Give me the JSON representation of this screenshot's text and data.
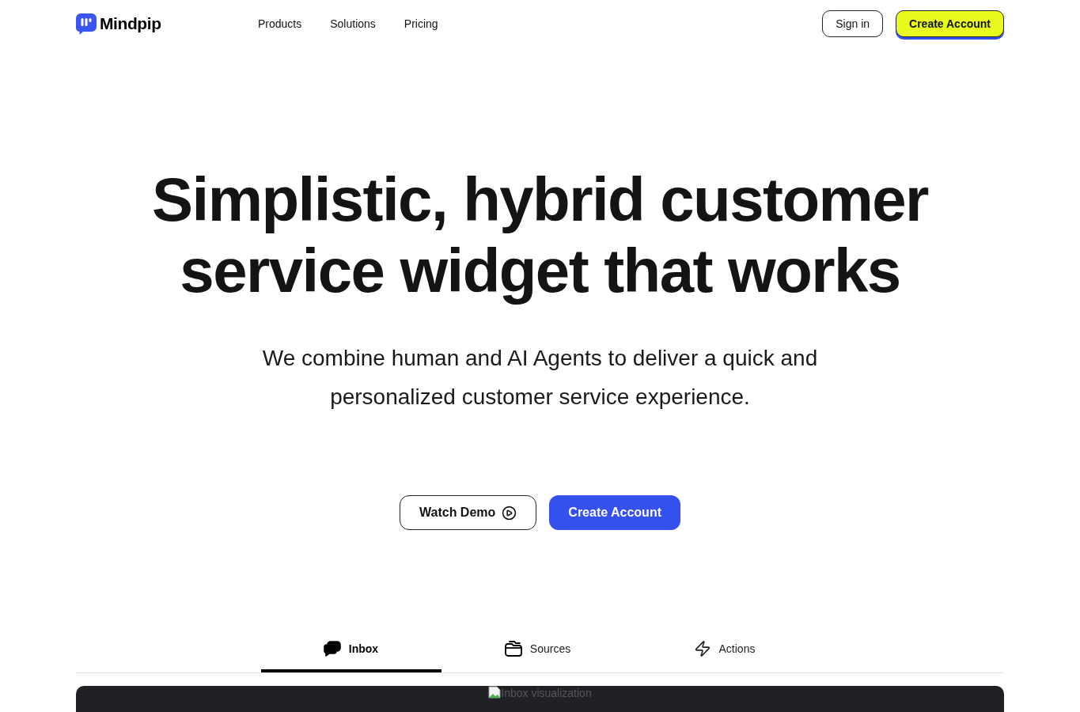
{
  "nav": {
    "logo": "Mindpip",
    "links": [
      "Products",
      "Solutions",
      "Pricing"
    ],
    "sign_in": "Sign in",
    "create_account": "Create Account"
  },
  "hero": {
    "title_lines": [
      "Simplistic, hybrid customer",
      "service widget that works"
    ],
    "subtitle": "We combine human and AI Agents to deliver a quick and personalized customer service experience.",
    "buttons": [
      {
        "kind": "outline",
        "label": "Watch Demo"
      },
      {
        "kind": "primary",
        "label": "Create Account"
      }
    ]
  },
  "tabs": [
    {
      "label": "Inbox",
      "selected": true
    },
    {
      "label": "Sources",
      "selected": false
    },
    {
      "label": "Actions",
      "selected": false
    }
  ],
  "preview": {
    "alt_text": "Inbox visualization"
  }
}
